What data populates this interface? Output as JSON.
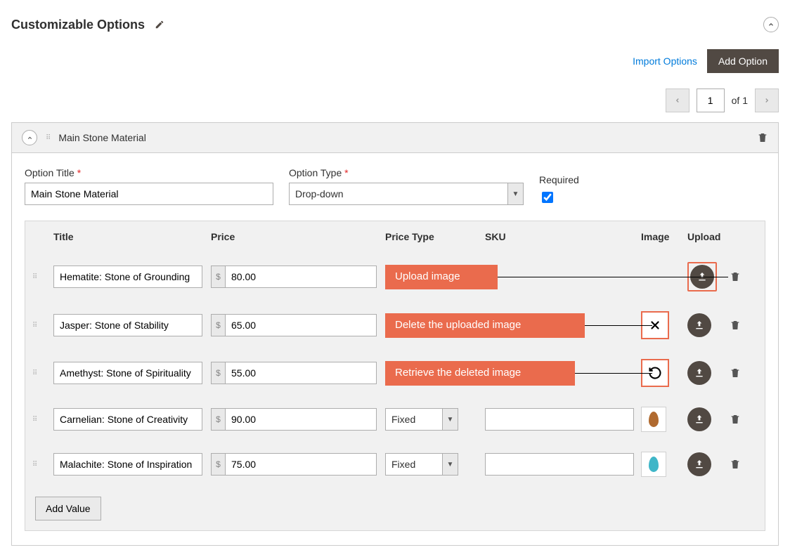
{
  "section": {
    "title": "Customizable Options"
  },
  "actions": {
    "import_label": "Import Options",
    "add_option_label": "Add Option"
  },
  "pagination": {
    "current": "1",
    "of_text": "of",
    "total": "1"
  },
  "option": {
    "header_title": "Main Stone Material",
    "labels": {
      "option_title": "Option Title",
      "option_type": "Option Type",
      "required": "Required"
    },
    "title_value": "Main Stone Material",
    "type_value": "Drop-down",
    "required_checked": true,
    "columns": {
      "title": "Title",
      "price": "Price",
      "price_type": "Price Type",
      "sku": "SKU",
      "image": "Image",
      "upload": "Upload"
    },
    "rows": [
      {
        "title": "Hematite: Stone of Grounding",
        "price": "80.00",
        "callout": "Upload image",
        "callout_kind": "upload",
        "price_type": "",
        "sku": "",
        "image_action": "",
        "stone_color": ""
      },
      {
        "title": "Jasper: Stone of Stability",
        "price": "65.00",
        "callout": "Delete the uploaded image",
        "callout_kind": "delete",
        "price_type": "",
        "sku": "",
        "image_action": "delete",
        "stone_color": ""
      },
      {
        "title": "Amethyst: Stone of Spirituality",
        "price": "55.00",
        "callout": "Retrieve the deleted image",
        "callout_kind": "retrieve",
        "price_type": "",
        "sku": "",
        "image_action": "retrieve",
        "stone_color": ""
      },
      {
        "title": "Carnelian: Stone of Creativity",
        "price": "90.00",
        "callout": "",
        "callout_kind": "",
        "price_type": "Fixed",
        "sku": "",
        "image_action": "thumb",
        "stone_color": "#b06a2f"
      },
      {
        "title": "Malachite: Stone of Inspiration",
        "price": "75.00",
        "callout": "",
        "callout_kind": "",
        "price_type": "Fixed",
        "sku": "",
        "image_action": "thumb",
        "stone_color": "#3fb6c8"
      }
    ],
    "add_value_label": "Add Value"
  }
}
